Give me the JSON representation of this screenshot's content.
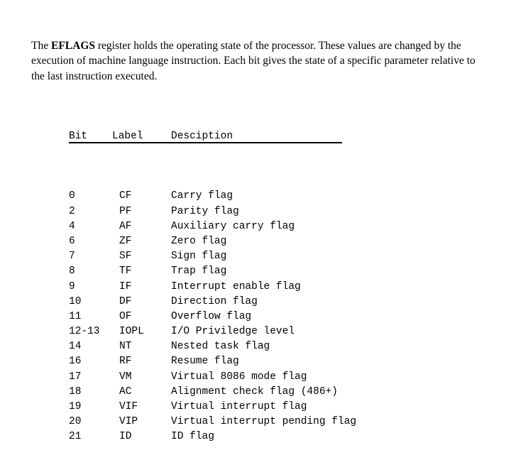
{
  "intro": {
    "before": "The ",
    "bold": "EFLAGS",
    "after": " register holds the operating state of the processor. These values are changed by the execution of machine language instruction. Each bit gives the state of a specific parameter relative to the last instruction executed."
  },
  "table": {
    "headers": {
      "bit": "Bit",
      "label": "Label",
      "description": "Desciption"
    },
    "rows": [
      {
        "bit": "0",
        "label": "CF",
        "description": "Carry flag"
      },
      {
        "bit": "2",
        "label": "PF",
        "description": "Parity flag"
      },
      {
        "bit": "4",
        "label": "AF",
        "description": "Auxiliary carry flag"
      },
      {
        "bit": "6",
        "label": "ZF",
        "description": "Zero flag"
      },
      {
        "bit": "7",
        "label": "SF",
        "description": "Sign flag"
      },
      {
        "bit": "8",
        "label": "TF",
        "description": "Trap flag"
      },
      {
        "bit": "9",
        "label": "IF",
        "description": "Interrupt enable flag"
      },
      {
        "bit": "10",
        "label": "DF",
        "description": "Direction flag"
      },
      {
        "bit": "11",
        "label": "OF",
        "description": "Overflow flag"
      },
      {
        "bit": "12-13",
        "label": "IOPL",
        "description": "I/O Priviledge level"
      },
      {
        "bit": "14",
        "label": "NT",
        "description": "Nested task flag"
      },
      {
        "bit": "16",
        "label": "RF",
        "description": "Resume flag"
      },
      {
        "bit": "17",
        "label": "VM",
        "description": "Virtual 8086 mode flag"
      },
      {
        "bit": "18",
        "label": "AC",
        "description": "Alignment check flag (486+)"
      },
      {
        "bit": "19",
        "label": "VIF",
        "description": "Virtual interrupt flag"
      },
      {
        "bit": "20",
        "label": "VIP",
        "description": "Virtual interrupt pending flag"
      },
      {
        "bit": "21",
        "label": "ID",
        "description": "ID flag"
      }
    ]
  },
  "colors": {
    "text": "#000000",
    "background": "#ffffff",
    "rule": "#000000"
  }
}
